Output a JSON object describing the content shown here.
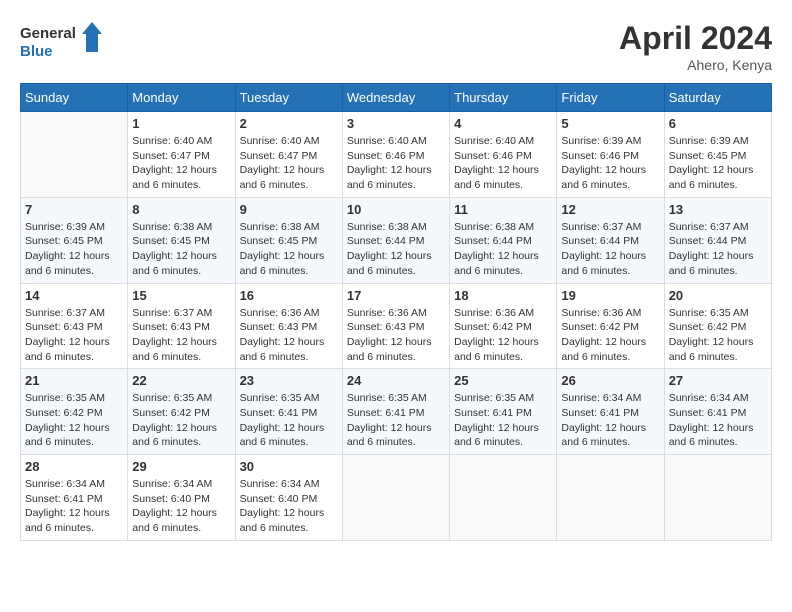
{
  "header": {
    "logo_line1": "General",
    "logo_line2": "Blue",
    "month": "April 2024",
    "location": "Ahero, Kenya"
  },
  "days_of_week": [
    "Sunday",
    "Monday",
    "Tuesday",
    "Wednesday",
    "Thursday",
    "Friday",
    "Saturday"
  ],
  "weeks": [
    [
      {
        "day": "",
        "sunrise": "",
        "sunset": "",
        "daylight": ""
      },
      {
        "day": "1",
        "sunrise": "Sunrise: 6:40 AM",
        "sunset": "Sunset: 6:47 PM",
        "daylight": "Daylight: 12 hours and 6 minutes."
      },
      {
        "day": "2",
        "sunrise": "Sunrise: 6:40 AM",
        "sunset": "Sunset: 6:47 PM",
        "daylight": "Daylight: 12 hours and 6 minutes."
      },
      {
        "day": "3",
        "sunrise": "Sunrise: 6:40 AM",
        "sunset": "Sunset: 6:46 PM",
        "daylight": "Daylight: 12 hours and 6 minutes."
      },
      {
        "day": "4",
        "sunrise": "Sunrise: 6:40 AM",
        "sunset": "Sunset: 6:46 PM",
        "daylight": "Daylight: 12 hours and 6 minutes."
      },
      {
        "day": "5",
        "sunrise": "Sunrise: 6:39 AM",
        "sunset": "Sunset: 6:46 PM",
        "daylight": "Daylight: 12 hours and 6 minutes."
      },
      {
        "day": "6",
        "sunrise": "Sunrise: 6:39 AM",
        "sunset": "Sunset: 6:45 PM",
        "daylight": "Daylight: 12 hours and 6 minutes."
      }
    ],
    [
      {
        "day": "7",
        "sunrise": "Sunrise: 6:39 AM",
        "sunset": "Sunset: 6:45 PM",
        "daylight": "Daylight: 12 hours and 6 minutes."
      },
      {
        "day": "8",
        "sunrise": "Sunrise: 6:38 AM",
        "sunset": "Sunset: 6:45 PM",
        "daylight": "Daylight: 12 hours and 6 minutes."
      },
      {
        "day": "9",
        "sunrise": "Sunrise: 6:38 AM",
        "sunset": "Sunset: 6:45 PM",
        "daylight": "Daylight: 12 hours and 6 minutes."
      },
      {
        "day": "10",
        "sunrise": "Sunrise: 6:38 AM",
        "sunset": "Sunset: 6:44 PM",
        "daylight": "Daylight: 12 hours and 6 minutes."
      },
      {
        "day": "11",
        "sunrise": "Sunrise: 6:38 AM",
        "sunset": "Sunset: 6:44 PM",
        "daylight": "Daylight: 12 hours and 6 minutes."
      },
      {
        "day": "12",
        "sunrise": "Sunrise: 6:37 AM",
        "sunset": "Sunset: 6:44 PM",
        "daylight": "Daylight: 12 hours and 6 minutes."
      },
      {
        "day": "13",
        "sunrise": "Sunrise: 6:37 AM",
        "sunset": "Sunset: 6:44 PM",
        "daylight": "Daylight: 12 hours and 6 minutes."
      }
    ],
    [
      {
        "day": "14",
        "sunrise": "Sunrise: 6:37 AM",
        "sunset": "Sunset: 6:43 PM",
        "daylight": "Daylight: 12 hours and 6 minutes."
      },
      {
        "day": "15",
        "sunrise": "Sunrise: 6:37 AM",
        "sunset": "Sunset: 6:43 PM",
        "daylight": "Daylight: 12 hours and 6 minutes."
      },
      {
        "day": "16",
        "sunrise": "Sunrise: 6:36 AM",
        "sunset": "Sunset: 6:43 PM",
        "daylight": "Daylight: 12 hours and 6 minutes."
      },
      {
        "day": "17",
        "sunrise": "Sunrise: 6:36 AM",
        "sunset": "Sunset: 6:43 PM",
        "daylight": "Daylight: 12 hours and 6 minutes."
      },
      {
        "day": "18",
        "sunrise": "Sunrise: 6:36 AM",
        "sunset": "Sunset: 6:42 PM",
        "daylight": "Daylight: 12 hours and 6 minutes."
      },
      {
        "day": "19",
        "sunrise": "Sunrise: 6:36 AM",
        "sunset": "Sunset: 6:42 PM",
        "daylight": "Daylight: 12 hours and 6 minutes."
      },
      {
        "day": "20",
        "sunrise": "Sunrise: 6:35 AM",
        "sunset": "Sunset: 6:42 PM",
        "daylight": "Daylight: 12 hours and 6 minutes."
      }
    ],
    [
      {
        "day": "21",
        "sunrise": "Sunrise: 6:35 AM",
        "sunset": "Sunset: 6:42 PM",
        "daylight": "Daylight: 12 hours and 6 minutes."
      },
      {
        "day": "22",
        "sunrise": "Sunrise: 6:35 AM",
        "sunset": "Sunset: 6:42 PM",
        "daylight": "Daylight: 12 hours and 6 minutes."
      },
      {
        "day": "23",
        "sunrise": "Sunrise: 6:35 AM",
        "sunset": "Sunset: 6:41 PM",
        "daylight": "Daylight: 12 hours and 6 minutes."
      },
      {
        "day": "24",
        "sunrise": "Sunrise: 6:35 AM",
        "sunset": "Sunset: 6:41 PM",
        "daylight": "Daylight: 12 hours and 6 minutes."
      },
      {
        "day": "25",
        "sunrise": "Sunrise: 6:35 AM",
        "sunset": "Sunset: 6:41 PM",
        "daylight": "Daylight: 12 hours and 6 minutes."
      },
      {
        "day": "26",
        "sunrise": "Sunrise: 6:34 AM",
        "sunset": "Sunset: 6:41 PM",
        "daylight": "Daylight: 12 hours and 6 minutes."
      },
      {
        "day": "27",
        "sunrise": "Sunrise: 6:34 AM",
        "sunset": "Sunset: 6:41 PM",
        "daylight": "Daylight: 12 hours and 6 minutes."
      }
    ],
    [
      {
        "day": "28",
        "sunrise": "Sunrise: 6:34 AM",
        "sunset": "Sunset: 6:41 PM",
        "daylight": "Daylight: 12 hours and 6 minutes."
      },
      {
        "day": "29",
        "sunrise": "Sunrise: 6:34 AM",
        "sunset": "Sunset: 6:40 PM",
        "daylight": "Daylight: 12 hours and 6 minutes."
      },
      {
        "day": "30",
        "sunrise": "Sunrise: 6:34 AM",
        "sunset": "Sunset: 6:40 PM",
        "daylight": "Daylight: 12 hours and 6 minutes."
      },
      {
        "day": "",
        "sunrise": "",
        "sunset": "",
        "daylight": ""
      },
      {
        "day": "",
        "sunrise": "",
        "sunset": "",
        "daylight": ""
      },
      {
        "day": "",
        "sunrise": "",
        "sunset": "",
        "daylight": ""
      },
      {
        "day": "",
        "sunrise": "",
        "sunset": "",
        "daylight": ""
      }
    ]
  ]
}
